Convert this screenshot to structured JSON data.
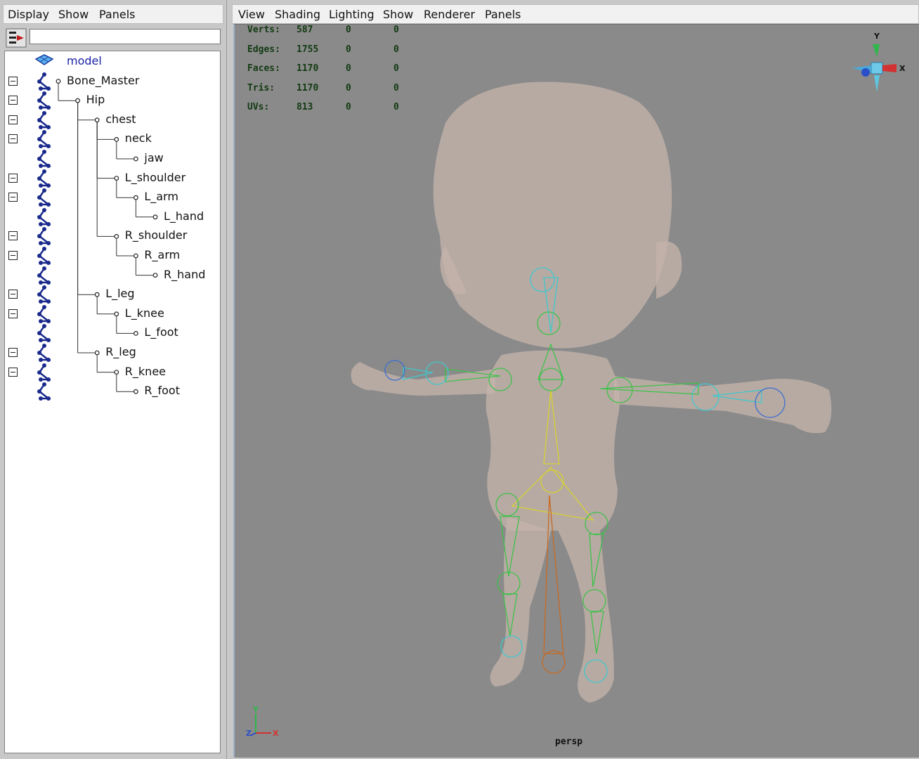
{
  "outliner": {
    "menu": [
      "Display",
      "Show",
      "Panels"
    ],
    "filter_value": "",
    "items": [
      {
        "label": "model",
        "kind": "mesh",
        "collapsible": false
      },
      {
        "label": "Bone_Master",
        "kind": "joint",
        "collapsible": true
      },
      {
        "label": "Hip",
        "kind": "joint",
        "collapsible": true
      },
      {
        "label": "chest",
        "kind": "joint",
        "collapsible": true
      },
      {
        "label": "neck",
        "kind": "joint",
        "collapsible": true
      },
      {
        "label": "jaw",
        "kind": "joint",
        "collapsible": false
      },
      {
        "label": "L_shoulder",
        "kind": "joint",
        "collapsible": true
      },
      {
        "label": "L_arm",
        "kind": "joint",
        "collapsible": true
      },
      {
        "label": "L_hand",
        "kind": "joint",
        "collapsible": false
      },
      {
        "label": "R_shoulder",
        "kind": "joint",
        "collapsible": true
      },
      {
        "label": "R_arm",
        "kind": "joint",
        "collapsible": true
      },
      {
        "label": "R_hand",
        "kind": "joint",
        "collapsible": false
      },
      {
        "label": "L_leg",
        "kind": "joint",
        "collapsible": true
      },
      {
        "label": "L_knee",
        "kind": "joint",
        "collapsible": true
      },
      {
        "label": "L_foot",
        "kind": "joint",
        "collapsible": false
      },
      {
        "label": "R_leg",
        "kind": "joint",
        "collapsible": true
      },
      {
        "label": "R_knee",
        "kind": "joint",
        "collapsible": true
      },
      {
        "label": "R_foot",
        "kind": "joint",
        "collapsible": false
      }
    ],
    "colors": {
      "model_label": "#1a22a8",
      "joint_icon": "#1a2a8c"
    }
  },
  "viewport": {
    "menu": [
      "View",
      "Shading",
      "Lighting",
      "Show",
      "Renderer",
      "Panels"
    ],
    "hud": [
      {
        "label": "Verts:",
        "values": [
          "587",
          "0",
          "0"
        ]
      },
      {
        "label": "Edges:",
        "values": [
          "1755",
          "0",
          "0"
        ]
      },
      {
        "label": "Faces:",
        "values": [
          "1170",
          "0",
          "0"
        ]
      },
      {
        "label": "Tris:",
        "values": [
          "1170",
          "0",
          "0"
        ]
      },
      {
        "label": "UVs:",
        "values": [
          "813",
          "0",
          "0"
        ]
      }
    ],
    "camera": "persp",
    "view_cube": {
      "top_axis": "Y",
      "side_axis": "X"
    },
    "axis_labels": {
      "x": "X",
      "y": "Y",
      "z": "Z"
    },
    "colors": {
      "background": "#8a8a8a",
      "hud_text": "#123a12",
      "skin": "#c4b3aa",
      "bone_green": "#3ec24a",
      "bone_yellow": "#d6d231",
      "bone_cyan": "#40c8cc",
      "bone_blue": "#3a6ed0",
      "bone_orange": "#c86a22"
    }
  }
}
